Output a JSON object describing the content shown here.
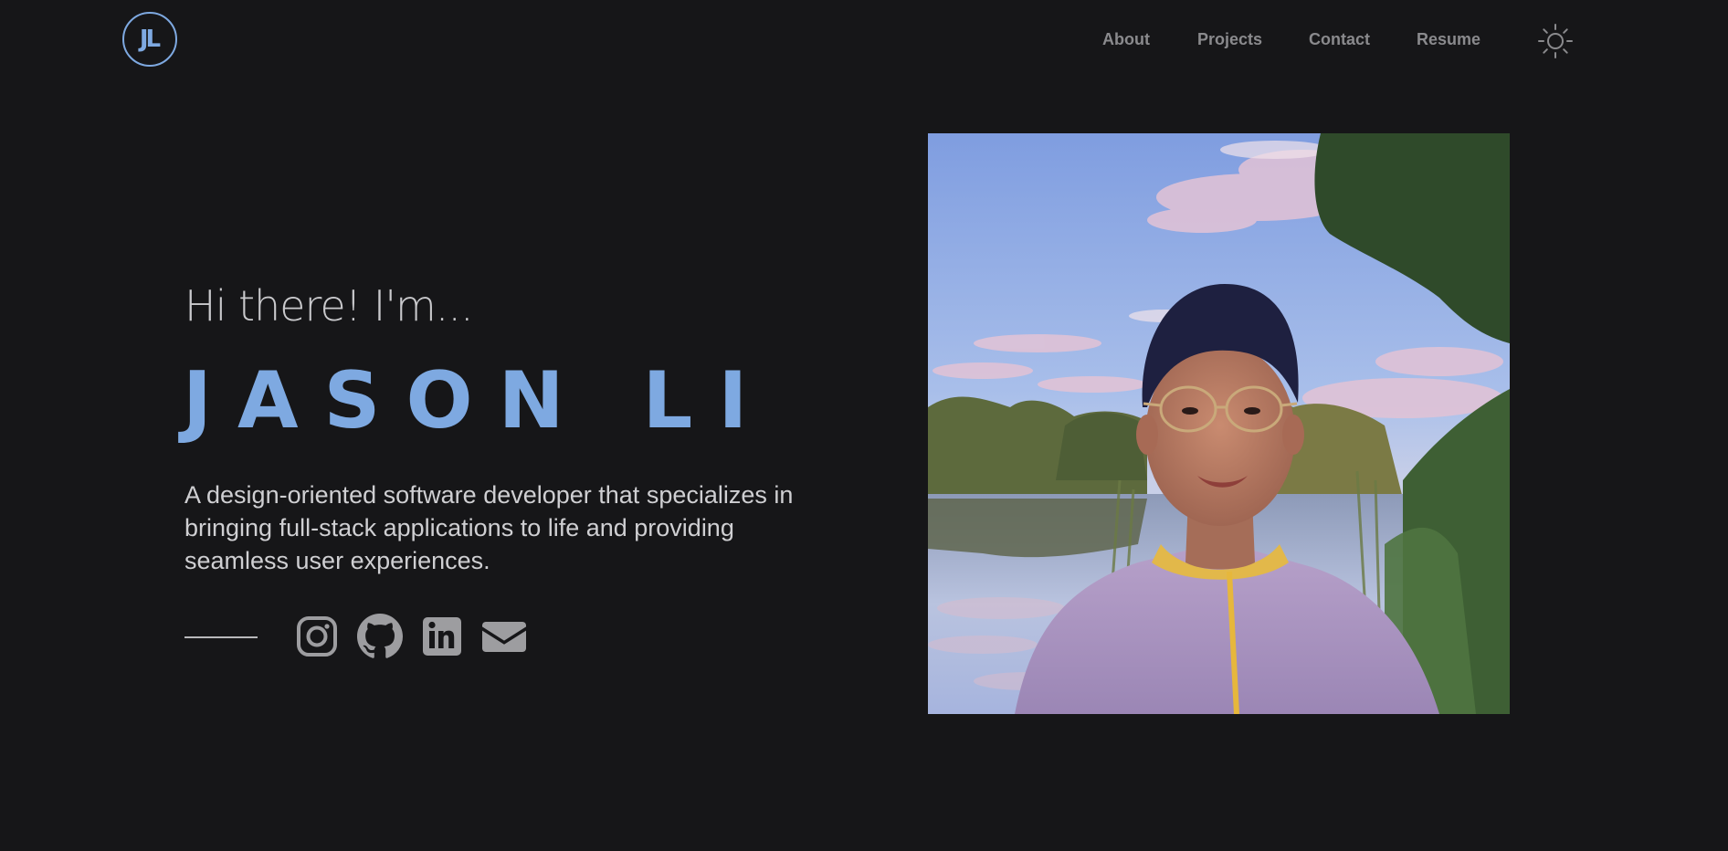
{
  "header": {
    "logo_text": "JL",
    "nav": [
      {
        "label": "About"
      },
      {
        "label": "Projects"
      },
      {
        "label": "Contact"
      },
      {
        "label": "Resume"
      }
    ],
    "theme_toggle_icon": "sun-icon"
  },
  "hero": {
    "greeting": "Hi there! I'm...",
    "name": "JASON LI",
    "tagline": "A design-oriented software developer that specializes in bringing full-stack applications to life and providing seamless user experiences.",
    "socials": [
      {
        "icon": "instagram-icon"
      },
      {
        "icon": "github-icon"
      },
      {
        "icon": "linkedin-icon"
      },
      {
        "icon": "email-icon"
      }
    ]
  },
  "colors": {
    "background": "#161618",
    "accent": "#7ea9e1",
    "nav_text": "#8a8a8d",
    "body_text": "#cfcfd2"
  }
}
